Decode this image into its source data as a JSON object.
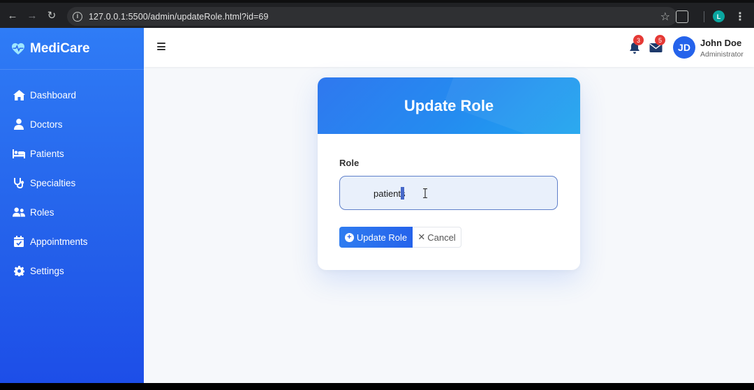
{
  "browser": {
    "url": "127.0.0.1:5500/admin/updateRole.html?id=69",
    "profile_initial": "L"
  },
  "sidebar": {
    "brand": "MediCare",
    "items": [
      {
        "label": "Dashboard",
        "icon": "home-icon"
      },
      {
        "label": "Doctors",
        "icon": "user-doctor-icon"
      },
      {
        "label": "Patients",
        "icon": "bed-icon"
      },
      {
        "label": "Specialties",
        "icon": "stethoscope-icon"
      },
      {
        "label": "Roles",
        "icon": "users-icon"
      },
      {
        "label": "Appointments",
        "icon": "calendar-check-icon"
      },
      {
        "label": "Settings",
        "icon": "gear-icon"
      }
    ]
  },
  "topbar": {
    "notifications_count": "3",
    "messages_count": "5",
    "avatar_initials": "JD",
    "user_name": "John Doe",
    "user_role": "Administrator"
  },
  "form": {
    "title": "Update Role",
    "role_label": "Role",
    "role_value": "patients",
    "submit_label": "Update Role",
    "cancel_label": "Cancel"
  },
  "colors": {
    "primary": "#2563eb",
    "badge": "#e53935"
  }
}
